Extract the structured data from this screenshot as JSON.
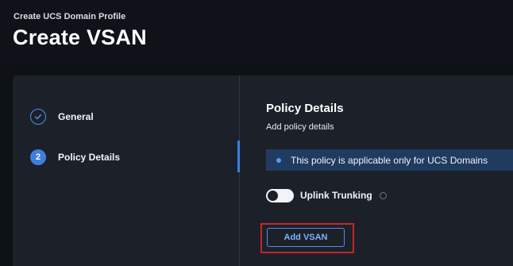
{
  "header": {
    "breadcrumb": "Create UCS Domain Profile",
    "title": "Create VSAN"
  },
  "steps": [
    {
      "label": "General",
      "state": "completed",
      "icon": "check-icon"
    },
    {
      "label": "Policy Details",
      "state": "active",
      "number": "2"
    }
  ],
  "details": {
    "title": "Policy Details",
    "subtitle": "Add policy details",
    "info_banner": "This policy is applicable only for UCS Domains",
    "uplink_trunking": {
      "label": "Uplink Trunking",
      "enabled": false
    },
    "add_button_label": "Add VSAN"
  },
  "colors": {
    "accent": "#3d7fe0",
    "highlight_border": "#c3262b",
    "banner_bg": "#1f3b5f"
  }
}
